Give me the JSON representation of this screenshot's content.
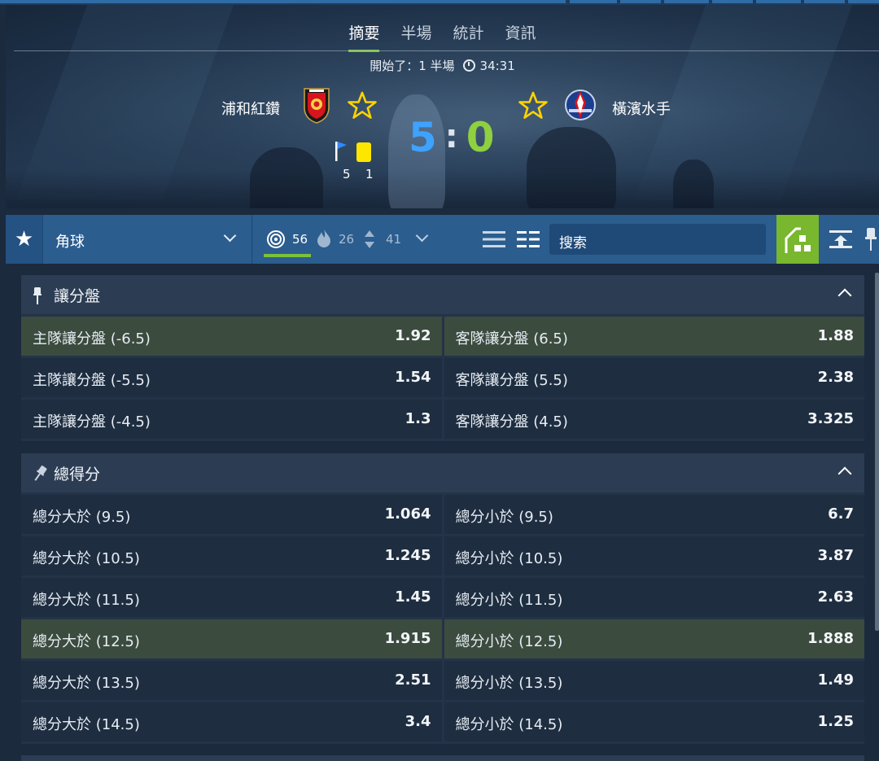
{
  "tabs": [
    {
      "label": "摘要",
      "active": true
    },
    {
      "label": "半場",
      "active": false
    },
    {
      "label": "統計",
      "active": false
    },
    {
      "label": "資訊",
      "active": false
    }
  ],
  "match": {
    "status": "開始了：1 半場",
    "clock": "34:31",
    "home": {
      "name": "浦和紅鑽",
      "score": "5",
      "corners": "5",
      "yellow_cards": "1"
    },
    "away": {
      "name": "橫濱水手",
      "score": "0"
    },
    "score_separator": ":",
    "colors": {
      "home_score": "#3ea2ff",
      "away_score": "#8ed03f",
      "accent": "#7cc13a",
      "star": "#ffd400"
    }
  },
  "toolbar": {
    "market_filter": "角球",
    "counts": {
      "target": "56",
      "fire": "26",
      "updown": "41"
    },
    "search_placeholder": "搜索"
  },
  "markets": [
    {
      "title": "讓分盤",
      "rows": [
        [
          {
            "name": "主隊讓分盤 (-6.5)",
            "odds": "1.92",
            "hl": true
          },
          {
            "name": "客隊讓分盤 (6.5)",
            "odds": "1.88",
            "hl": true
          }
        ],
        [
          {
            "name": "主隊讓分盤 (-5.5)",
            "odds": "1.54",
            "hl": false
          },
          {
            "name": "客隊讓分盤 (5.5)",
            "odds": "2.38",
            "hl": false
          }
        ],
        [
          {
            "name": "主隊讓分盤 (-4.5)",
            "odds": "1.3",
            "hl": false
          },
          {
            "name": "客隊讓分盤 (4.5)",
            "odds": "3.325",
            "hl": false
          }
        ]
      ]
    },
    {
      "title": "總得分",
      "rows": [
        [
          {
            "name": "總分大於 (9.5)",
            "odds": "1.064",
            "hl": false
          },
          {
            "name": "總分小於 (9.5)",
            "odds": "6.7",
            "hl": false
          }
        ],
        [
          {
            "name": "總分大於 (10.5)",
            "odds": "1.245",
            "hl": false
          },
          {
            "name": "總分小於 (10.5)",
            "odds": "3.87",
            "hl": false
          }
        ],
        [
          {
            "name": "總分大於 (11.5)",
            "odds": "1.45",
            "hl": false
          },
          {
            "name": "總分小於 (11.5)",
            "odds": "2.63",
            "hl": false
          }
        ],
        [
          {
            "name": "總分大於 (12.5)",
            "odds": "1.915",
            "hl": true
          },
          {
            "name": "總分小於 (12.5)",
            "odds": "1.888",
            "hl": true
          }
        ],
        [
          {
            "name": "總分大於 (13.5)",
            "odds": "2.51",
            "hl": false
          },
          {
            "name": "總分小於 (13.5)",
            "odds": "1.49",
            "hl": false
          }
        ],
        [
          {
            "name": "總分大於 (14.5)",
            "odds": "3.4",
            "hl": false
          },
          {
            "name": "總分小於 (14.5)",
            "odds": "1.25",
            "hl": false
          }
        ]
      ]
    }
  ]
}
